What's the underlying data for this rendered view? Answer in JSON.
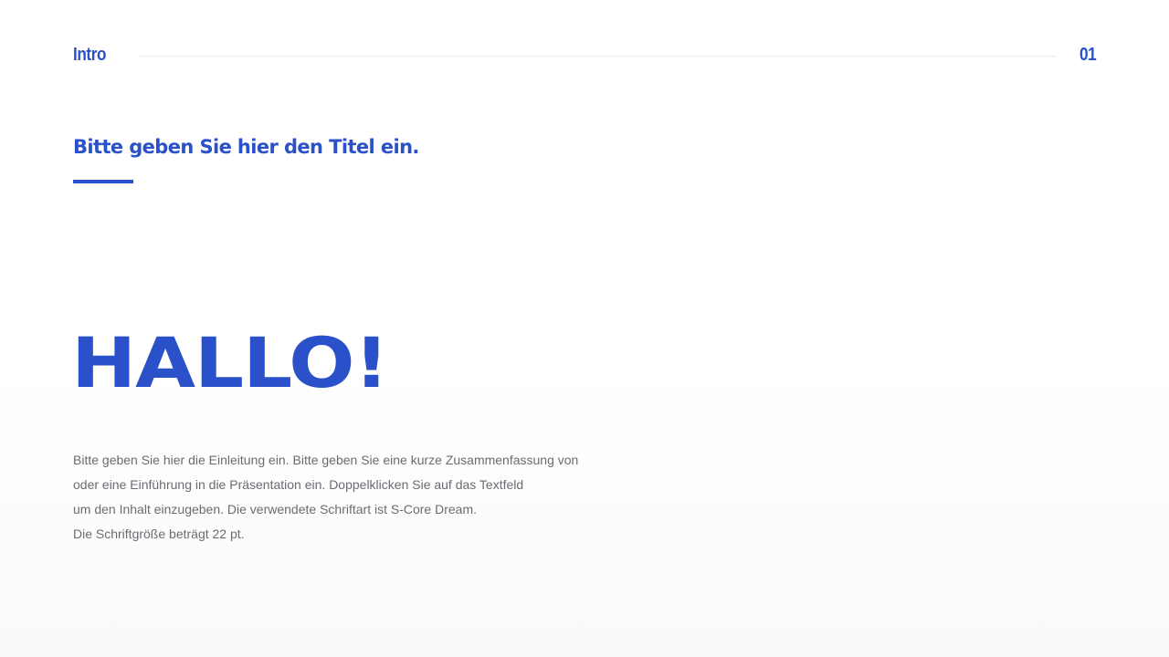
{
  "header": {
    "section": "Intro",
    "page_number": "01"
  },
  "slide": {
    "title": "Bitte geben Sie hier den Titel ein.",
    "headline": "HALLO!",
    "intro_lines": [
      "Bitte geben Sie hier die Einleitung ein. Bitte geben Sie eine kurze Zusammenfassung von",
      "oder eine Einführung in die Präsentation ein. Doppelklicken Sie auf das Textfeld",
      "um den Inhalt einzugeben. Die verwendete Schriftart ist S-Core Dream.",
      "Die Schriftgröße beträgt 22 pt."
    ]
  },
  "colors": {
    "accent": "#2a51c9",
    "body_text": "#6b6b72",
    "rule": "#ececf0",
    "background": "#ffffff"
  }
}
